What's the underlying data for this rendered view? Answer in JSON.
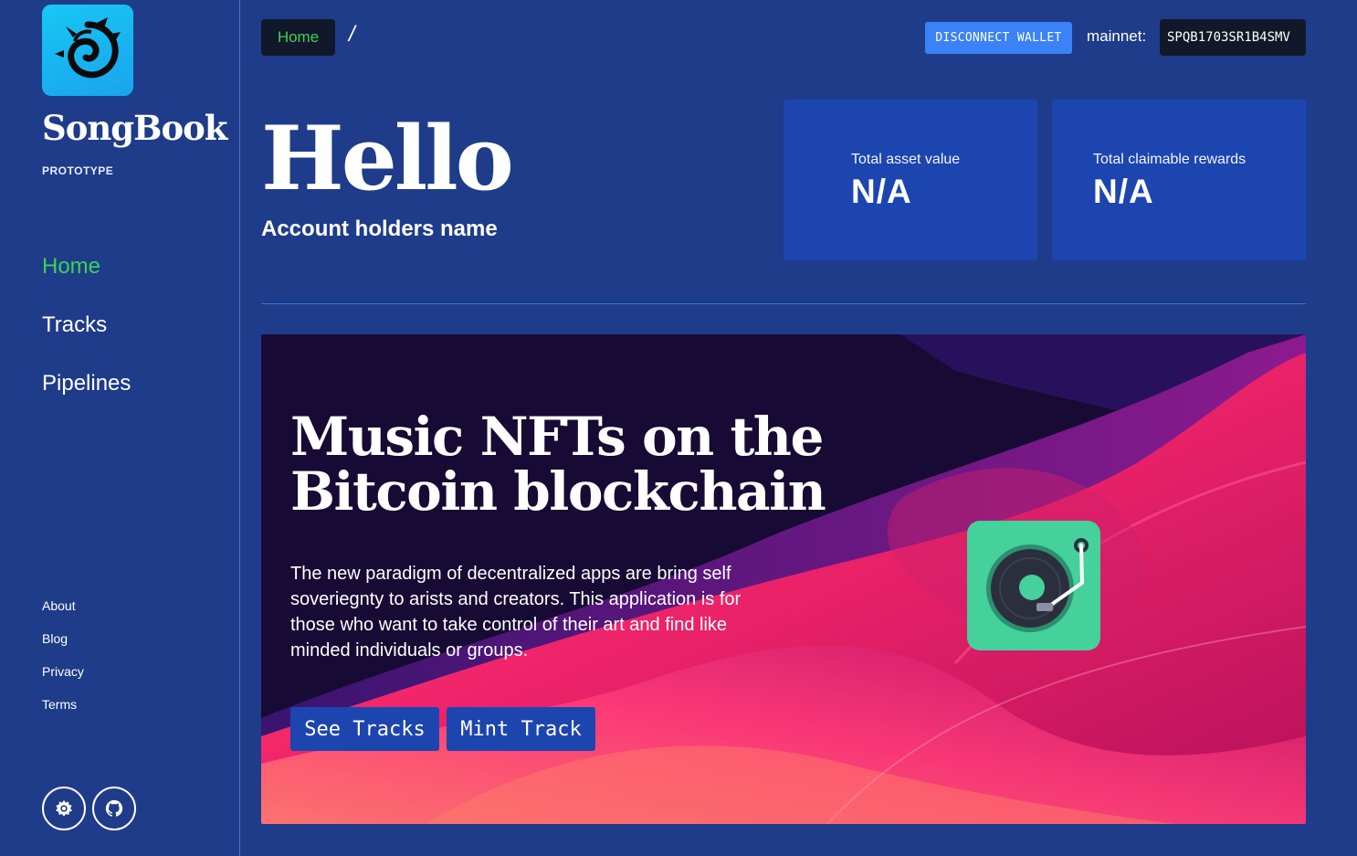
{
  "app": {
    "brand": "SongBook",
    "tagline": "PROTOTYPE"
  },
  "sidebar": {
    "nav": [
      {
        "label": "Home",
        "active": true
      },
      {
        "label": "Tracks",
        "active": false
      },
      {
        "label": "Pipelines",
        "active": false
      }
    ],
    "footer_links": [
      "About",
      "Blog",
      "Privacy",
      "Terms"
    ],
    "icons": [
      "settings-icon",
      "github-icon"
    ]
  },
  "topbar": {
    "breadcrumb_home": "Home",
    "breadcrumb_separator": "/",
    "disconnect_label": "DISCONNECT WALLET",
    "network_label": "mainnet:",
    "address": "SPQB1703SR1B4SMV"
  },
  "greeting": {
    "title": "Hello",
    "account_name": "Account holders name"
  },
  "stats": {
    "asset_label": "Total asset value",
    "asset_value": "N/A",
    "rewards_label": "Total claimable rewards",
    "rewards_value": "N/A"
  },
  "hero": {
    "title_line1": "Music NFTs on the",
    "title_line2": "Bitcoin blockchain",
    "text": "The new paradigm of decentralized apps are bring self soveriegnty to arists and creators. This application is for those who want to take control of their art and find like minded individuals or groups.",
    "see_tracks_label": "See Tracks",
    "mint_track_label": "Mint Track",
    "icon": "turntable-icon"
  },
  "colors": {
    "background": "#1f3c8a",
    "card": "#1d45b0",
    "active_nav": "#3ed058",
    "disconnect_button": "#3a82f6",
    "dark_chip": "#11182a",
    "logo_bg": "#18c7f3",
    "turntable": "#44d19b"
  }
}
